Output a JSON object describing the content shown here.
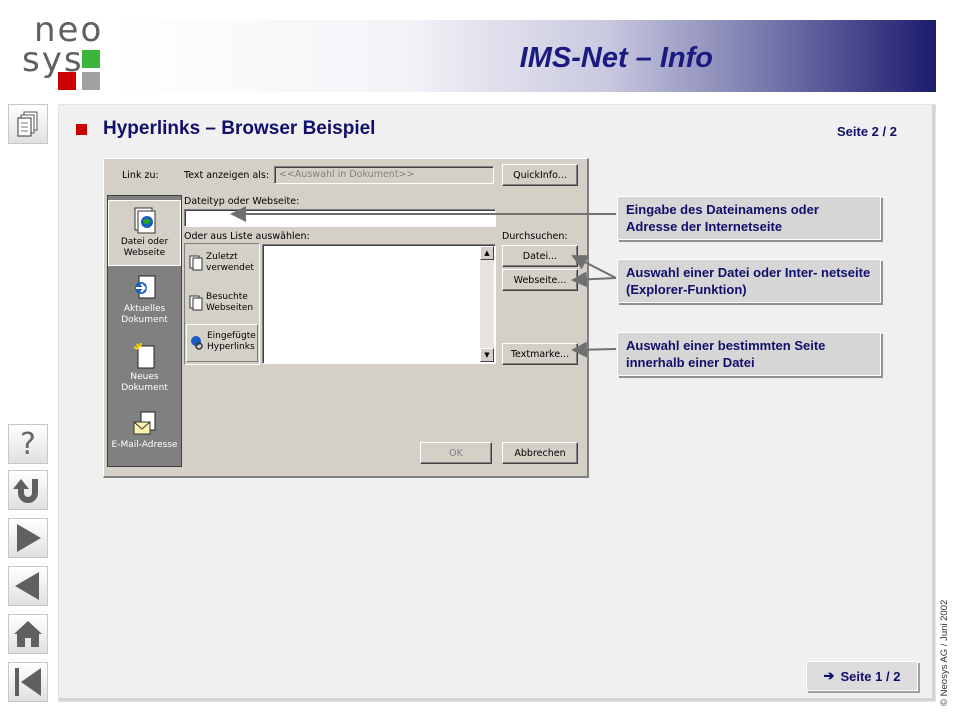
{
  "logo": {
    "line1": "neo",
    "line2": "sys",
    "colors": {
      "green": "#3cb53c",
      "red": "#cc0000",
      "gray": "#a0a0a0"
    }
  },
  "header": {
    "title": "IMS-Net – Info"
  },
  "nav": {
    "icons": [
      "notepad-icon",
      "help-icon",
      "return-icon",
      "next-icon",
      "previous-icon",
      "home-icon",
      "first-page-icon"
    ],
    "help_glyph": "?"
  },
  "slide": {
    "heading": "Hyperlinks – Browser Beispiel",
    "page_indicator": "Seite 2 / 2"
  },
  "dialog": {
    "link_to_label": "Link zu:",
    "text_show_label": "Text anzeigen als:",
    "text_show_value": "<<Auswahl in Dokument>>",
    "quickinfo_button": "QuickInfo...",
    "filetype_label": "Dateityp oder Webseite:",
    "filetype_value": "",
    "list_label": "Oder aus Liste auswählen:",
    "browse_label": "Durchsuchen:",
    "datei_button": "Datei...",
    "webseite_button": "Webseite...",
    "textmarke_button": "Textmarke...",
    "ok_button": "OK",
    "cancel_button": "Abbrechen",
    "link_types": [
      {
        "label": "Datei oder Webseite",
        "selected": true
      },
      {
        "label": "Aktuelles Dokument",
        "selected": false
      },
      {
        "label": "Neues Dokument",
        "selected": false
      },
      {
        "label": "E-Mail-Adresse",
        "selected": false
      }
    ],
    "history": [
      {
        "label": "Zuletzt verwendet"
      },
      {
        "label": "Besuchte Webseiten"
      },
      {
        "label": "Eingefügte Hyperlinks",
        "selected": true
      }
    ]
  },
  "callouts": {
    "c1": "Eingabe des Dateinamens oder Adresse der Internetseite",
    "c2": "Auswahl einer Datei oder Inter- netseite (Explorer-Funktion)",
    "c3": "Auswahl einer bestimmten Seite innerhalb einer Datei"
  },
  "footer": {
    "next_link": "Seite 1 / 2",
    "copyright": "© Neosys AG / Juni 2002"
  }
}
